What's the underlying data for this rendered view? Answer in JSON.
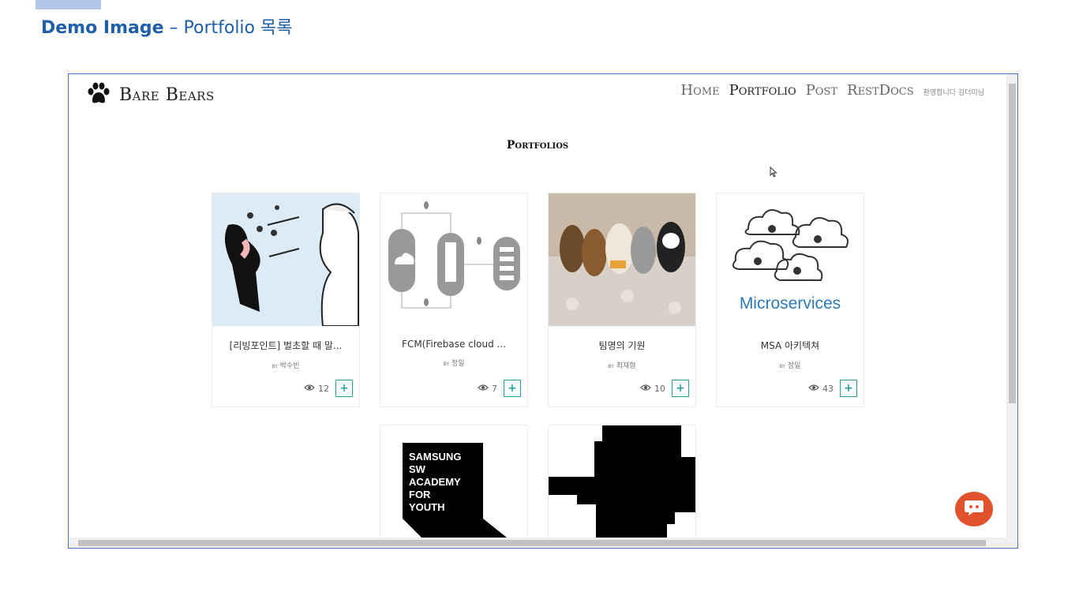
{
  "caption": {
    "bold": "Demo Image",
    "rest": " – Portfolio 목록"
  },
  "brand": {
    "name": "Bare Bears",
    "icon": "paw-icon"
  },
  "nav": {
    "home": "Home",
    "portfolio": "Portfolio",
    "post": "Post",
    "restdocs": "RestDocs",
    "welcome": "환영합니다 김더미님"
  },
  "section_title": "Portfolios",
  "cards": [
    {
      "title": "[리빙포인트] 벌초할 때 말...",
      "author": "by 박수빈",
      "views": "12",
      "add": "+"
    },
    {
      "title": "FCM(Firebase cloud ...",
      "author": "by 정일",
      "views": "7",
      "add": "+"
    },
    {
      "title": "팀명의 기원",
      "author": "by 최재형",
      "views": "10",
      "add": "+"
    },
    {
      "title": "MSA 아키텍쳐",
      "author": "by 정일",
      "views": "43",
      "add": "+"
    }
  ],
  "thumb_texts": {
    "microservices": "Microservices",
    "ssafy": [
      "SAMSUNG",
      "SW",
      "ACADEMY",
      "FOR",
      "YOUTH"
    ]
  },
  "colors": {
    "accent": "#2aa198",
    "chat": "#e0532d",
    "caption": "#1f5fa8"
  }
}
